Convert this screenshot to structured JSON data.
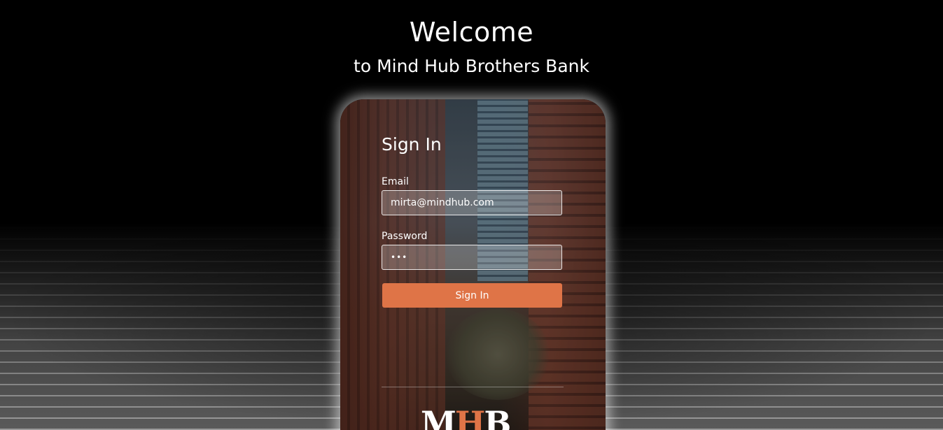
{
  "header": {
    "title": "Welcome",
    "subtitle": "to Mind Hub Brothers Bank"
  },
  "signin": {
    "title": "Sign In",
    "email_label": "Email",
    "email_value": "mirta@mindhub.com",
    "password_label": "Password",
    "password_value": "123",
    "button_label": "Sign In"
  },
  "logo": {
    "letters": [
      "M",
      "H",
      "B"
    ],
    "accent_color": "#df7447"
  },
  "colors": {
    "accent": "#df7447",
    "background": "#000000"
  }
}
